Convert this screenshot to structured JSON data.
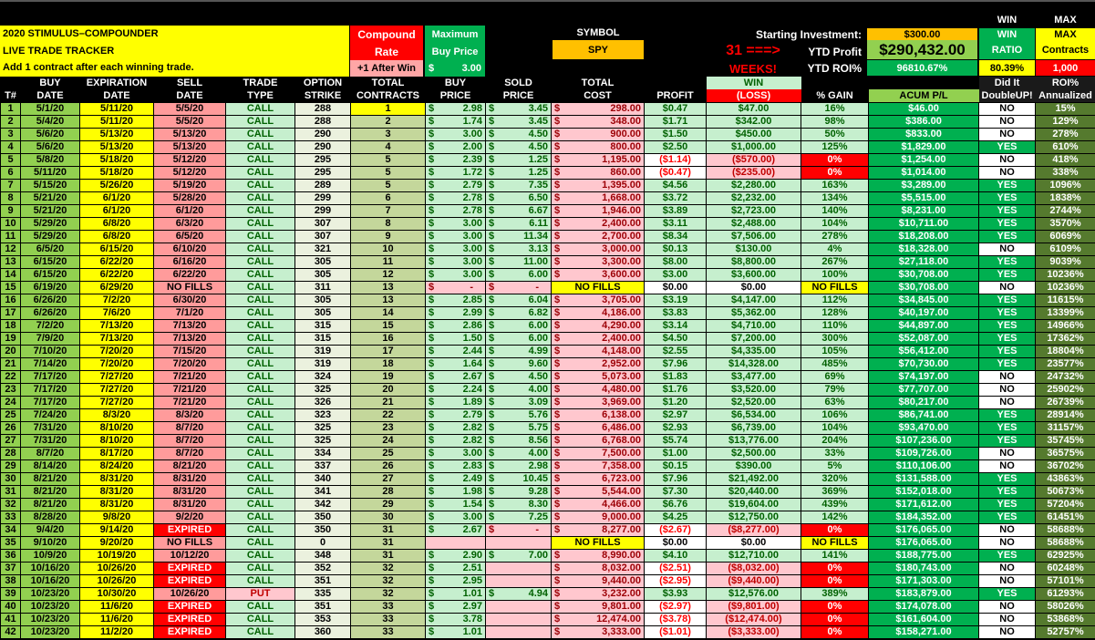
{
  "title": {
    "line1": "2020 STIMULUS–COMPOUNDER",
    "line2": "LIVE TRADE TRACKER",
    "line3": "Add 1 contract after each winning trade."
  },
  "compound": {
    "line1": "Compound",
    "line2": "Rate",
    "value": "+1 After Win"
  },
  "max_buy": {
    "line1": "Maximum",
    "line2": "Buy Price",
    "currency": "$",
    "value": "3.00"
  },
  "symbol": {
    "label": "SYMBOL",
    "value": "SPY"
  },
  "weeks": {
    "line1": "31 ===>",
    "line2": "WEEKS!"
  },
  "summary": {
    "starting_label": "Starting Investment:",
    "starting_value": "$300.00",
    "ytd_profit_label": "YTD Profit",
    "ytd_profit_value": "$290,432.00",
    "ytd_roi_label": "YTD ROI%",
    "ytd_roi_value": "96810.67%"
  },
  "win_box": {
    "top_label": "WIN",
    "line1": "WIN",
    "line2": "RATIO",
    "value": "80.39%"
  },
  "max_box": {
    "top_label": "MAX",
    "line1": "MAX",
    "line2": "Contracts",
    "value": "1,000"
  },
  "columns": [
    [
      "",
      "T#"
    ],
    [
      "BUY",
      "DATE"
    ],
    [
      "EXPIRATION",
      "DATE"
    ],
    [
      "SELL",
      "DATE"
    ],
    [
      "TRADE",
      "TYPE"
    ],
    [
      "OPTION",
      "STRIKE"
    ],
    [
      "TOTAL",
      "CONTRACTS"
    ],
    [
      "BUY",
      "PRICE"
    ],
    [
      "SOLD",
      "PRICE"
    ],
    [
      "TOTAL",
      "COST"
    ],
    [
      "",
      "PROFIT"
    ],
    [
      "WIN",
      "(LOSS)"
    ],
    [
      "",
      "% GAIN"
    ],
    [
      "",
      "ACUM P/L"
    ],
    [
      "Did It",
      "DoubleUP!"
    ],
    [
      "ROI%",
      "Annualized"
    ]
  ],
  "rows": [
    [
      "1",
      "5/1/20",
      "5/11/20",
      "5/5/20",
      "CALL",
      "288",
      "1",
      "2.98",
      "3.45",
      "298.00",
      "$0.47",
      "$47.00",
      "16%",
      "$46.00",
      "NO",
      "15%"
    ],
    [
      "2",
      "5/4/20",
      "5/11/20",
      "5/5/20",
      "CALL",
      "288",
      "2",
      "1.74",
      "3.45",
      "348.00",
      "$1.71",
      "$342.00",
      "98%",
      "$386.00",
      "NO",
      "129%"
    ],
    [
      "3",
      "5/6/20",
      "5/13/20",
      "5/13/20",
      "CALL",
      "290",
      "3",
      "3.00",
      "4.50",
      "900.00",
      "$1.50",
      "$450.00",
      "50%",
      "$833.00",
      "NO",
      "278%"
    ],
    [
      "4",
      "5/6/20",
      "5/13/20",
      "5/13/20",
      "CALL",
      "290",
      "4",
      "2.00",
      "4.50",
      "800.00",
      "$2.50",
      "$1,000.00",
      "125%",
      "$1,829.00",
      "YES",
      "610%"
    ],
    [
      "5",
      "5/8/20",
      "5/18/20",
      "5/12/20",
      "CALL",
      "295",
      "5",
      "2.39",
      "1.25",
      "1,195.00",
      "($1.14)",
      "($570.00)",
      "0%",
      "$1,254.00",
      "NO",
      "418%"
    ],
    [
      "6",
      "5/11/20",
      "5/18/20",
      "5/12/20",
      "CALL",
      "295",
      "5",
      "1.72",
      "1.25",
      "860.00",
      "($0.47)",
      "($235.00)",
      "0%",
      "$1,014.00",
      "NO",
      "338%"
    ],
    [
      "7",
      "5/15/20",
      "5/26/20",
      "5/19/20",
      "CALL",
      "289",
      "5",
      "2.79",
      "7.35",
      "1,395.00",
      "$4.56",
      "$2,280.00",
      "163%",
      "$3,289.00",
      "YES",
      "1096%"
    ],
    [
      "8",
      "5/21/20",
      "6/1/20",
      "5/28/20",
      "CALL",
      "299",
      "6",
      "2.78",
      "6.50",
      "1,668.00",
      "$3.72",
      "$2,232.00",
      "134%",
      "$5,515.00",
      "YES",
      "1838%"
    ],
    [
      "9",
      "5/21/20",
      "6/1/20",
      "6/1/20",
      "CALL",
      "299",
      "7",
      "2.78",
      "6.67",
      "1,946.00",
      "$3.89",
      "$2,723.00",
      "140%",
      "$8,231.00",
      "YES",
      "2744%"
    ],
    [
      "10",
      "5/29/20",
      "6/8/20",
      "6/3/20",
      "CALL",
      "307",
      "8",
      "3.00",
      "6.11",
      "2,400.00",
      "$3.11",
      "$2,488.00",
      "104%",
      "$10,711.00",
      "YES",
      "3570%"
    ],
    [
      "11",
      "5/29/20",
      "6/8/20",
      "6/5/20",
      "CALL",
      "307",
      "9",
      "3.00",
      "11.34",
      "2,700.00",
      "$8.34",
      "$7,506.00",
      "278%",
      "$18,208.00",
      "YES",
      "6069%"
    ],
    [
      "12",
      "6/5/20",
      "6/15/20",
      "6/10/20",
      "CALL",
      "321",
      "10",
      "3.00",
      "3.13",
      "3,000.00",
      "$0.13",
      "$130.00",
      "4%",
      "$18,328.00",
      "NO",
      "6109%"
    ],
    [
      "13",
      "6/15/20",
      "6/22/20",
      "6/16/20",
      "CALL",
      "305",
      "11",
      "3.00",
      "11.00",
      "3,300.00",
      "$8.00",
      "$8,800.00",
      "267%",
      "$27,118.00",
      "YES",
      "9039%"
    ],
    [
      "14",
      "6/15/20",
      "6/22/20",
      "6/22/20",
      "CALL",
      "305",
      "12",
      "3.00",
      "6.00",
      "3,600.00",
      "$3.00",
      "$3,600.00",
      "100%",
      "$30,708.00",
      "YES",
      "10236%"
    ],
    [
      "15",
      "6/19/20",
      "6/29/20",
      "NO FILLS",
      "CALL",
      "311",
      "13",
      "-",
      "-",
      "NO FILLS",
      "$0.00",
      "$0.00",
      "NO FILLS",
      "$30,708.00",
      "NO",
      "10236%"
    ],
    [
      "16",
      "6/26/20",
      "7/2/20",
      "6/30/20",
      "CALL",
      "305",
      "13",
      "2.85",
      "6.04",
      "3,705.00",
      "$3.19",
      "$4,147.00",
      "112%",
      "$34,845.00",
      "YES",
      "11615%"
    ],
    [
      "17",
      "6/26/20",
      "7/6/20",
      "7/1/20",
      "CALL",
      "305",
      "14",
      "2.99",
      "6.82",
      "4,186.00",
      "$3.83",
      "$5,362.00",
      "128%",
      "$40,197.00",
      "YES",
      "13399%"
    ],
    [
      "18",
      "7/2/20",
      "7/13/20",
      "7/13/20",
      "CALL",
      "315",
      "15",
      "2.86",
      "6.00",
      "4,290.00",
      "$3.14",
      "$4,710.00",
      "110%",
      "$44,897.00",
      "YES",
      "14966%"
    ],
    [
      "19",
      "7/9/20",
      "7/13/20",
      "7/13/20",
      "CALL",
      "315",
      "16",
      "1.50",
      "6.00",
      "2,400.00",
      "$4.50",
      "$7,200.00",
      "300%",
      "$52,087.00",
      "YES",
      "17362%"
    ],
    [
      "20",
      "7/10/20",
      "7/20/20",
      "7/15/20",
      "CALL",
      "319",
      "17",
      "2.44",
      "4.99",
      "4,148.00",
      "$2.55",
      "$4,335.00",
      "105%",
      "$56,412.00",
      "YES",
      "18804%"
    ],
    [
      "21",
      "7/14/20",
      "7/20/20",
      "7/20/20",
      "CALL",
      "319",
      "18",
      "1.64",
      "9.60",
      "2,952.00",
      "$7.96",
      "$14,328.00",
      "485%",
      "$70,730.00",
      "YES",
      "23577%"
    ],
    [
      "22",
      "7/17/20",
      "7/27/20",
      "7/21/20",
      "CALL",
      "324",
      "19",
      "2.67",
      "4.50",
      "5,073.00",
      "$1.83",
      "$3,477.00",
      "69%",
      "$74,197.00",
      "NO",
      "24732%"
    ],
    [
      "23",
      "7/17/20",
      "7/27/20",
      "7/21/20",
      "CALL",
      "325",
      "20",
      "2.24",
      "4.00",
      "4,480.00",
      "$1.76",
      "$3,520.00",
      "79%",
      "$77,707.00",
      "NO",
      "25902%"
    ],
    [
      "24",
      "7/17/20",
      "7/27/20",
      "7/21/20",
      "CALL",
      "326",
      "21",
      "1.89",
      "3.09",
      "3,969.00",
      "$1.20",
      "$2,520.00",
      "63%",
      "$80,217.00",
      "NO",
      "26739%"
    ],
    [
      "25",
      "7/24/20",
      "8/3/20",
      "8/3/20",
      "CALL",
      "323",
      "22",
      "2.79",
      "5.76",
      "6,138.00",
      "$2.97",
      "$6,534.00",
      "106%",
      "$86,741.00",
      "YES",
      "28914%"
    ],
    [
      "26",
      "7/31/20",
      "8/10/20",
      "8/7/20",
      "CALL",
      "325",
      "23",
      "2.82",
      "5.75",
      "6,486.00",
      "$2.93",
      "$6,739.00",
      "104%",
      "$93,470.00",
      "YES",
      "31157%"
    ],
    [
      "27",
      "7/31/20",
      "8/10/20",
      "8/7/20",
      "CALL",
      "325",
      "24",
      "2.82",
      "8.56",
      "6,768.00",
      "$5.74",
      "$13,776.00",
      "204%",
      "$107,236.00",
      "YES",
      "35745%"
    ],
    [
      "28",
      "8/7/20",
      "8/17/20",
      "8/7/20",
      "CALL",
      "334",
      "25",
      "3.00",
      "4.00",
      "7,500.00",
      "$1.00",
      "$2,500.00",
      "33%",
      "$109,726.00",
      "NO",
      "36575%"
    ],
    [
      "29",
      "8/14/20",
      "8/24/20",
      "8/21/20",
      "CALL",
      "337",
      "26",
      "2.83",
      "2.98",
      "7,358.00",
      "$0.15",
      "$390.00",
      "5%",
      "$110,106.00",
      "NO",
      "36702%"
    ],
    [
      "30",
      "8/21/20",
      "8/31/20",
      "8/31/20",
      "CALL",
      "340",
      "27",
      "2.49",
      "10.45",
      "6,723.00",
      "$7.96",
      "$21,492.00",
      "320%",
      "$131,588.00",
      "YES",
      "43863%"
    ],
    [
      "31",
      "8/21/20",
      "8/31/20",
      "8/31/20",
      "CALL",
      "341",
      "28",
      "1.98",
      "9.28",
      "5,544.00",
      "$7.30",
      "$20,440.00",
      "369%",
      "$152,018.00",
      "YES",
      "50673%"
    ],
    [
      "32",
      "8/21/20",
      "8/31/20",
      "8/31/20",
      "CALL",
      "342",
      "29",
      "1.54",
      "8.30",
      "4,466.00",
      "$6.76",
      "$19,604.00",
      "439%",
      "$171,612.00",
      "YES",
      "57204%"
    ],
    [
      "33",
      "8/28/20",
      "9/8/20",
      "9/2/20",
      "CALL",
      "350",
      "30",
      "3.00",
      "7.25",
      "9,000.00",
      "$4.25",
      "$12,750.00",
      "142%",
      "$184,352.00",
      "YES",
      "61451%"
    ],
    [
      "34",
      "9/4/20",
      "9/14/20",
      "EXPIRED",
      "CALL",
      "350",
      "31",
      "2.67",
      "-",
      "8,277.00",
      "($2.67)",
      "($8,277.00)",
      "0%",
      "$176,065.00",
      "NO",
      "58688%"
    ],
    [
      "35",
      "9/10/20",
      "9/20/20",
      "NO FILLS",
      "CALL",
      "0",
      "31",
      "",
      "",
      "NO FILLS",
      "$0.00",
      "$0.00",
      "NO FILLS",
      "$176,065.00",
      "NO",
      "58688%"
    ],
    [
      "36",
      "10/9/20",
      "10/19/20",
      "10/12/20",
      "CALL",
      "348",
      "31",
      "2.90",
      "7.00",
      "8,990.00",
      "$4.10",
      "$12,710.00",
      "141%",
      "$188,775.00",
      "YES",
      "62925%"
    ],
    [
      "37",
      "10/16/20",
      "10/26/20",
      "EXPIRED",
      "CALL",
      "352",
      "32",
      "2.51",
      "",
      "8,032.00",
      "($2.51)",
      "($8,032.00)",
      "0%",
      "$180,743.00",
      "NO",
      "60248%"
    ],
    [
      "38",
      "10/16/20",
      "10/26/20",
      "EXPIRED",
      "CALL",
      "351",
      "32",
      "2.95",
      "",
      "9,440.00",
      "($2.95)",
      "($9,440.00)",
      "0%",
      "$171,303.00",
      "NO",
      "57101%"
    ],
    [
      "39",
      "10/23/20",
      "10/30/20",
      "10/26/20",
      "PUT",
      "335",
      "32",
      "1.01",
      "4.94",
      "3,232.00",
      "$3.93",
      "$12,576.00",
      "389%",
      "$183,879.00",
      "YES",
      "61293%"
    ],
    [
      "40",
      "10/23/20",
      "11/6/20",
      "EXPIRED",
      "CALL",
      "351",
      "33",
      "2.97",
      "",
      "9,801.00",
      "($2.97)",
      "($9,801.00)",
      "0%",
      "$174,078.00",
      "NO",
      "58026%"
    ],
    [
      "41",
      "10/23/20",
      "11/6/20",
      "EXPIRED",
      "CALL",
      "353",
      "33",
      "3.78",
      "",
      "12,474.00",
      "($3.78)",
      "($12,474.00)",
      "0%",
      "$161,604.00",
      "NO",
      "53868%"
    ],
    [
      "42",
      "10/23/20",
      "11/2/20",
      "EXPIRED",
      "CALL",
      "360",
      "33",
      "1.01",
      "",
      "3,333.00",
      "($1.01)",
      "($3,333.00)",
      "0%",
      "$158,271.00",
      "NO",
      "52757%"
    ]
  ],
  "colors": {
    "green": "#00b050",
    "light_green": "#c6efce",
    "yellow": "#ffff00",
    "red": "#ff0000",
    "pink": "#ffc7ce",
    "olive": "#557a2e",
    "lime": "#92d050",
    "orange": "#ffc000"
  }
}
